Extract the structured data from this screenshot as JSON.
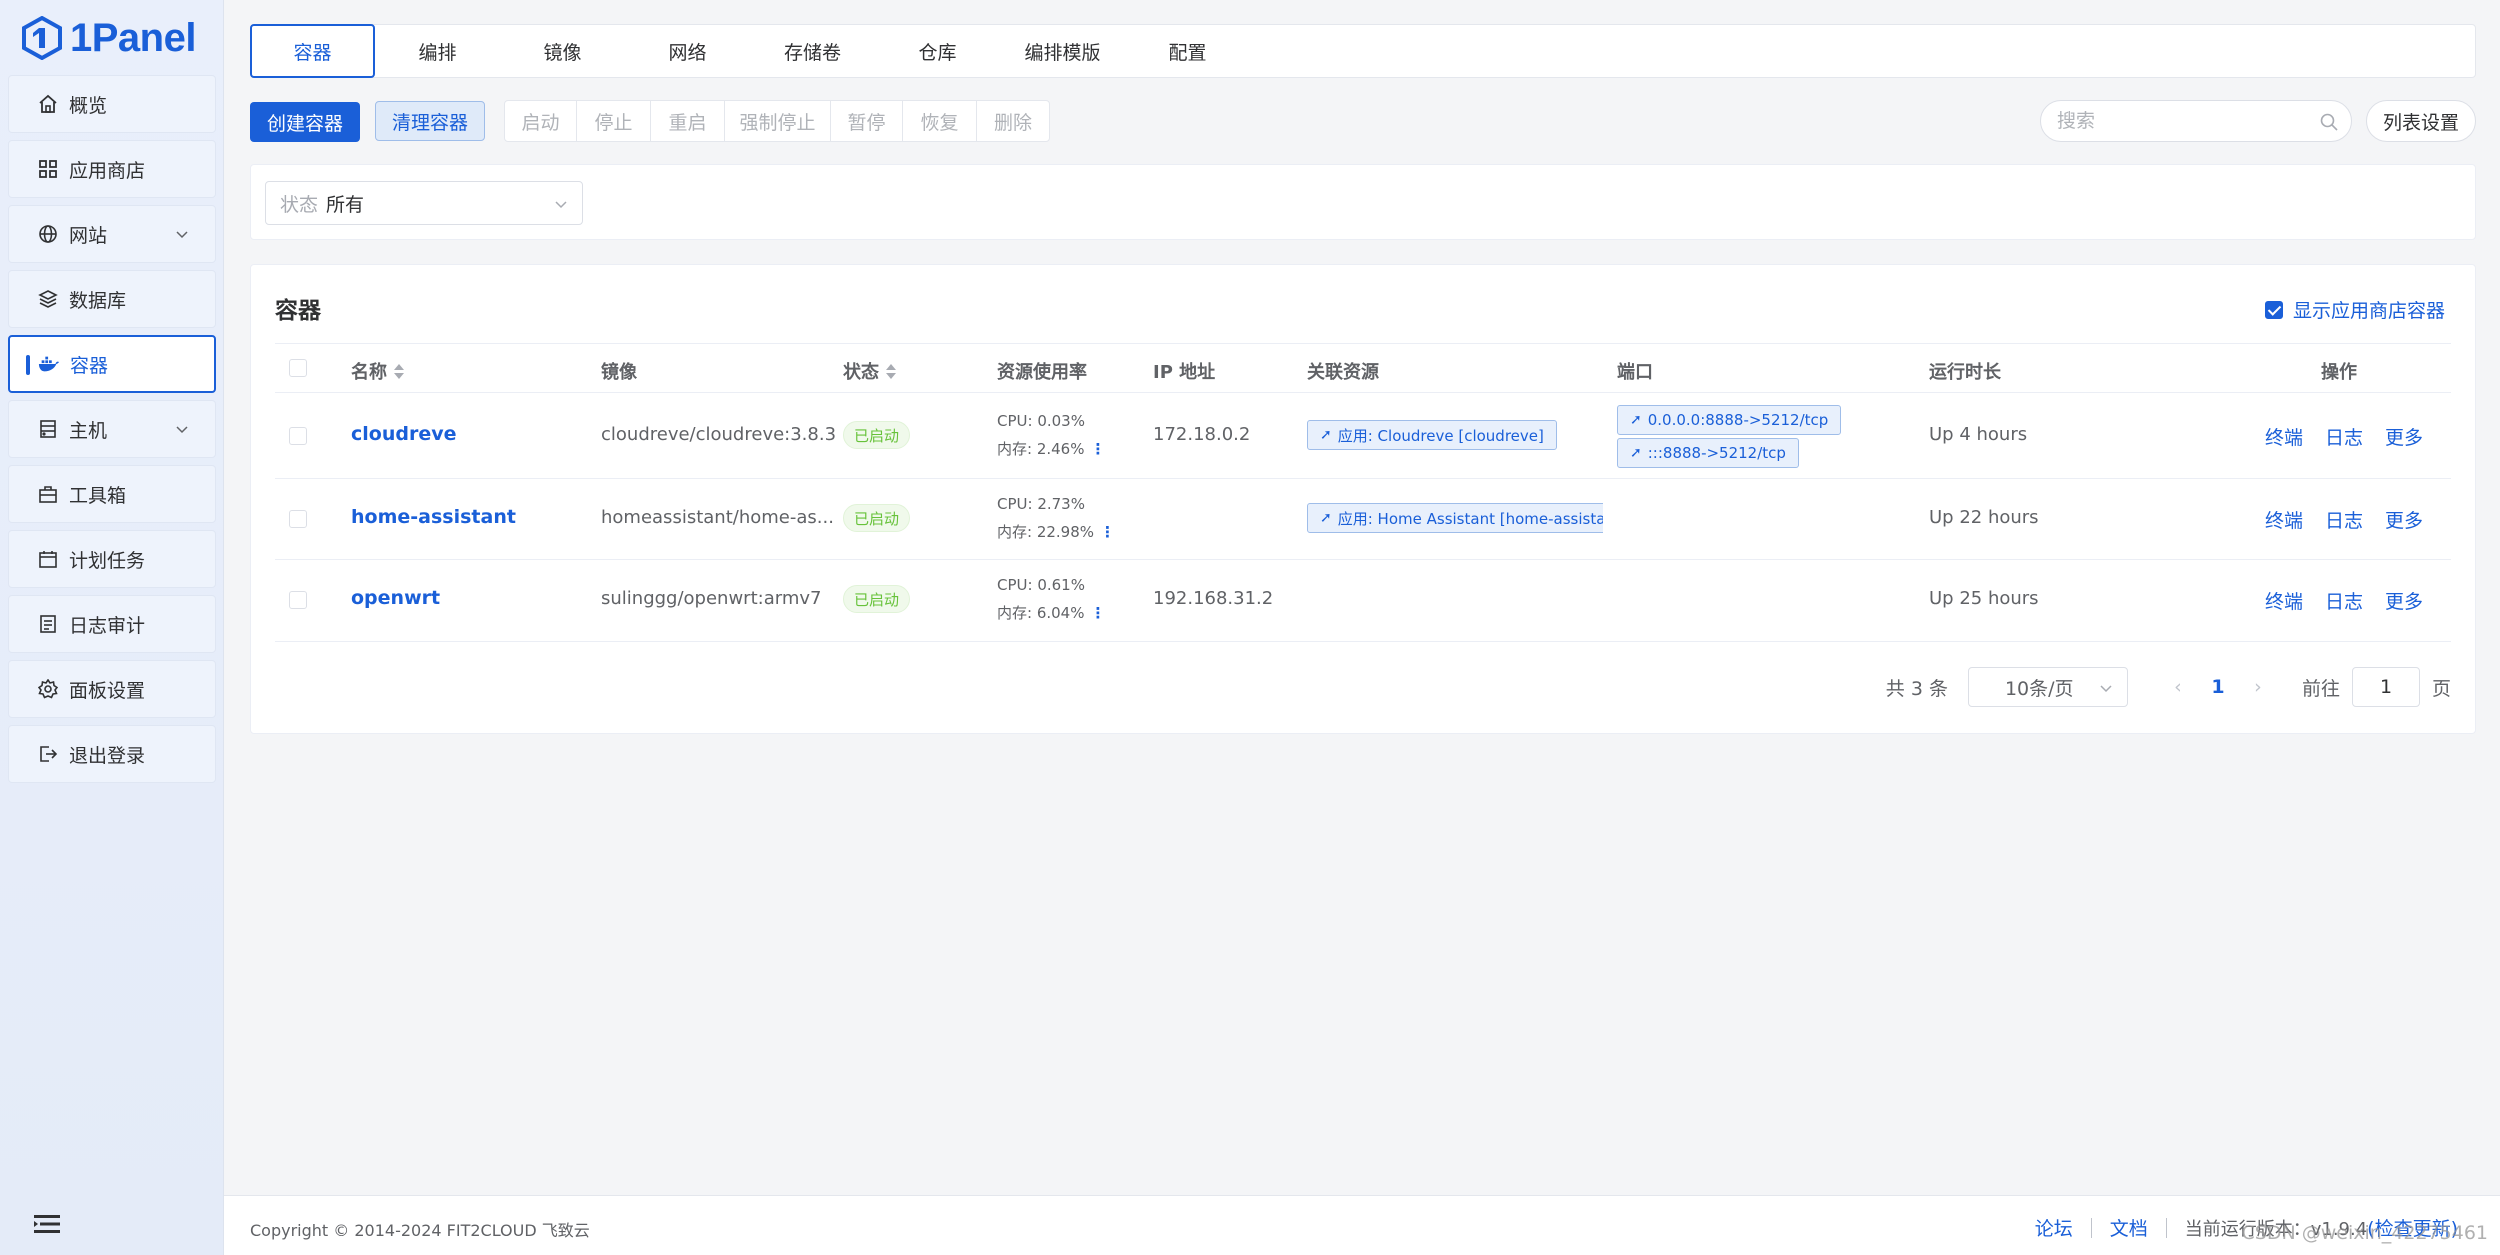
{
  "app": {
    "logo_text": "1Panel",
    "accent": "#1a5fd8"
  },
  "sidebar": {
    "items": [
      {
        "label": "概览",
        "icon": "home-icon"
      },
      {
        "label": "应用商店",
        "icon": "grid-icon"
      },
      {
        "label": "网站",
        "icon": "globe-icon",
        "expandable": true
      },
      {
        "label": "数据库",
        "icon": "layers-icon"
      },
      {
        "label": "容器",
        "icon": "docker-icon",
        "active": true
      },
      {
        "label": "主机",
        "icon": "host-icon",
        "expandable": true
      },
      {
        "label": "工具箱",
        "icon": "toolbox-icon"
      },
      {
        "label": "计划任务",
        "icon": "calendar-icon"
      },
      {
        "label": "日志审计",
        "icon": "log-icon"
      },
      {
        "label": "面板设置",
        "icon": "gear-icon"
      },
      {
        "label": "退出登录",
        "icon": "logout-icon"
      }
    ]
  },
  "tabs": [
    "容器",
    "编排",
    "镜像",
    "网络",
    "存储卷",
    "仓库",
    "编排模版",
    "配置"
  ],
  "toolbar": {
    "create_label": "创建容器",
    "prune_label": "清理容器",
    "actions": [
      "启动",
      "停止",
      "重启",
      "强制停止",
      "暂停",
      "恢复",
      "删除"
    ],
    "search_placeholder": "搜索",
    "list_settings_label": "列表设置"
  },
  "filter": {
    "status_label": "状态",
    "status_value": "所有"
  },
  "card": {
    "title": "容器",
    "show_app_label": "显示应用商店容器"
  },
  "table": {
    "headers": {
      "name": "名称",
      "image": "镜像",
      "status": "状态",
      "resources": "资源使用率",
      "ip": "IP 地址",
      "related": "关联资源",
      "ports": "端口",
      "uptime": "运行时长",
      "ops": "操作"
    },
    "rows": [
      {
        "name": "cloudreve",
        "image": "cloudreve/cloudreve:3.8.3",
        "status": "已启动",
        "cpu": "CPU: 0.03%",
        "mem": "内存: 2.46%",
        "ip": "172.18.0.2",
        "related": "应用: Cloudreve [cloudreve]",
        "ports": [
          "0.0.0.0:8888->5212/tcp",
          ":::8888->5212/tcp"
        ],
        "uptime": "Up 4 hours"
      },
      {
        "name": "home-assistant",
        "image": "homeassistant/home-as...",
        "status": "已启动",
        "cpu": "CPU: 2.73%",
        "mem": "内存: 22.98%",
        "ip": "",
        "related": "应用: Home Assistant [home-assistant]",
        "ports": [],
        "uptime": "Up 22 hours"
      },
      {
        "name": "openwrt",
        "image": "sulinggg/openwrt:armv7",
        "status": "已启动",
        "cpu": "CPU: 0.61%",
        "mem": "内存: 6.04%",
        "ip": "192.168.31.2",
        "related": "",
        "ports": [],
        "uptime": "Up 25 hours"
      }
    ],
    "op_labels": {
      "terminal": "终端",
      "log": "日志",
      "more": "更多"
    }
  },
  "pager": {
    "total": "共 3 条",
    "page_size": "10条/页",
    "current_page": "1",
    "goto_label": "前往",
    "goto_value": "1",
    "page_suffix": "页"
  },
  "footer": {
    "copyright": "Copyright © 2014-2024 FIT2CLOUD 飞致云",
    "forum": "论坛",
    "docs": "文档",
    "version": "当前运行版本：v1.9.4",
    "check_update": "(检查更新)",
    "watermark": "CSDN @weixin_42275461"
  }
}
